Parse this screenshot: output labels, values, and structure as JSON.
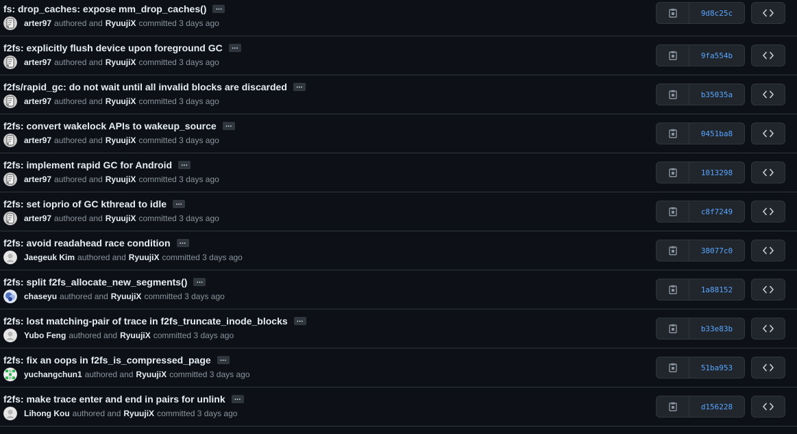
{
  "commits": [
    {
      "title": "fs: drop_caches: expose mm_drop_caches()",
      "author": "arter97",
      "committer": "RyuujiX",
      "authored_text": "authored and",
      "committed_text": "committed 3 days ago",
      "sha": "9d8c25c",
      "avatar": "avatar-arter97"
    },
    {
      "title": "f2fs: explicitly flush device upon foreground GC",
      "author": "arter97",
      "committer": "RyuujiX",
      "authored_text": "authored and",
      "committed_text": "committed 3 days ago",
      "sha": "9fa554b",
      "avatar": "avatar-arter97"
    },
    {
      "title": "f2fs/rapid_gc: do not wait until all invalid blocks are discarded",
      "author": "arter97",
      "committer": "RyuujiX",
      "authored_text": "authored and",
      "committed_text": "committed 3 days ago",
      "sha": "b35035a",
      "avatar": "avatar-arter97"
    },
    {
      "title": "f2fs: convert wakelock APIs to wakeup_source",
      "author": "arter97",
      "committer": "RyuujiX",
      "authored_text": "authored and",
      "committed_text": "committed 3 days ago",
      "sha": "0451ba8",
      "avatar": "avatar-arter97"
    },
    {
      "title": "f2fs: implement rapid GC for Android",
      "author": "arter97",
      "committer": "RyuujiX",
      "authored_text": "authored and",
      "committed_text": "committed 3 days ago",
      "sha": "1013298",
      "avatar": "avatar-arter97"
    },
    {
      "title": "f2fs: set ioprio of GC kthread to idle",
      "author": "arter97",
      "committer": "RyuujiX",
      "authored_text": "authored and",
      "committed_text": "committed 3 days ago",
      "sha": "c8f7249",
      "avatar": "avatar-arter97"
    },
    {
      "title": "f2fs: avoid readahead race condition",
      "author": "Jaegeuk Kim",
      "committer": "RyuujiX",
      "authored_text": "authored and",
      "committed_text": "committed 3 days ago",
      "sha": "38077c0",
      "avatar": "avatar-default"
    },
    {
      "title": "f2fs: split f2fs_allocate_new_segments()",
      "author": "chaseyu",
      "committer": "RyuujiX",
      "authored_text": "authored and",
      "committed_text": "committed 3 days ago",
      "sha": "1a88152",
      "avatar": "avatar-chaseyu"
    },
    {
      "title": "f2fs: lost matching-pair of trace in f2fs_truncate_inode_blocks",
      "author": "Yubo Feng",
      "committer": "RyuujiX",
      "authored_text": "authored and",
      "committed_text": "committed 3 days ago",
      "sha": "b33e83b",
      "avatar": "avatar-default"
    },
    {
      "title": "f2fs: fix an oops in f2fs_is_compressed_page",
      "author": "yuchangchun1",
      "committer": "RyuujiX",
      "authored_text": "authored and",
      "committed_text": "committed 3 days ago",
      "sha": "51ba953",
      "avatar": "avatar-identicon-green"
    },
    {
      "title": "f2fs: make trace enter and end in pairs for unlink",
      "author": "Lihong Kou",
      "committer": "RyuujiX",
      "authored_text": "authored and",
      "committed_text": "committed 3 days ago",
      "sha": "d156228",
      "avatar": "avatar-default"
    }
  ],
  "ui": {
    "ellipsis": "…",
    "copy_icon": "clipboard-icon",
    "browse_icon": "code-icon"
  },
  "colors": {
    "background": "#0d1117",
    "border": "#30363d",
    "link": "#58a6ff",
    "muted": "#8b949e",
    "text": "#e6edf3"
  }
}
